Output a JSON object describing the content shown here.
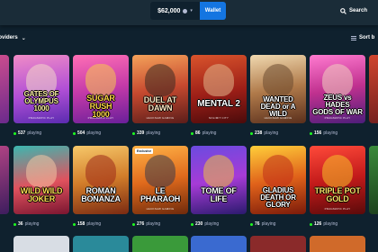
{
  "header": {
    "balance": "$62,000",
    "wallet_label": "Wallet",
    "search_label": "Search"
  },
  "filters": {
    "providers_label": "roviders",
    "sort_label": "Sort b"
  },
  "rows": [
    [
      {
        "title": "",
        "studio": "",
        "players": "",
        "players_suffix": ""
      },
      {
        "title": "GATES OF\nOLYMPUS\n1000",
        "studio": "PRAGMATIC PLAY",
        "players": "537",
        "players_suffix": "playing"
      },
      {
        "title": "SUGAR\nRUSH\n1000",
        "studio": "PRAGMATIC PLAY",
        "players": "504",
        "players_suffix": "playing"
      },
      {
        "title": "DUEL AT\nDAWN",
        "studio": "HACKSAW GAMING",
        "players": "339",
        "players_suffix": "playing"
      },
      {
        "title": "MENTAL 2",
        "studio": "NOLIMIT CITY",
        "players": "86",
        "players_suffix": "playing"
      },
      {
        "title": "WANTED\nDEAD or A WILD",
        "studio": "HACKSAW GAMING",
        "players": "238",
        "players_suffix": "playing"
      },
      {
        "title": "ZEUS vs\nHADES\nGODS OF WAR",
        "studio": "PRAGMATIC PLAY",
        "players": "156",
        "players_suffix": "playing"
      },
      {
        "title": "",
        "studio": "",
        "players": "",
        "players_suffix": ""
      }
    ],
    [
      {
        "title": "",
        "studio": "",
        "players": "",
        "players_suffix": ""
      },
      {
        "title": "WILD WILD\nJOKER",
        "studio": "",
        "players": "36",
        "players_suffix": "playing"
      },
      {
        "title": "ROMAN\nBONANZA",
        "studio": "",
        "players": "158",
        "players_suffix": "playing"
      },
      {
        "title": "LE\nPHARAOH",
        "studio": "HACKSAW GAMING",
        "players": "276",
        "players_suffix": "playing"
      },
      {
        "title": "TOME OF\nLIFE",
        "studio": "",
        "players": "230",
        "players_suffix": "playing"
      },
      {
        "title": "GLADIUS\nDEATH OR GLORY",
        "studio": "",
        "players": "76",
        "players_suffix": "playing"
      },
      {
        "title": "TRIPLE POT\nGOLD",
        "studio": "PRAGMATIC PLAY",
        "players": "126",
        "players_suffix": "playing"
      },
      {
        "title": "",
        "studio": "",
        "players": "",
        "players_suffix": ""
      }
    ]
  ],
  "badges": {
    "exclusive": "Exclusive"
  },
  "colors": {
    "background": "#0f212e",
    "topbar": "#1a2c38",
    "wallet": "#1475e1",
    "online_dot": "#1fff20",
    "muted_text": "#b1bad3"
  }
}
